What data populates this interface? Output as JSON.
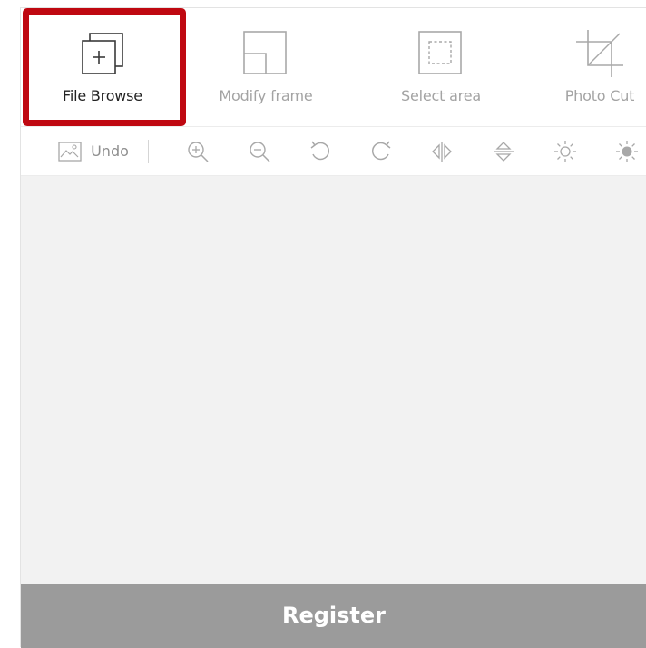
{
  "toolbar": {
    "tools": [
      {
        "label": "File Browse",
        "icon": "file-browse-icon",
        "active": true
      },
      {
        "label": "Modify frame",
        "icon": "modify-frame-icon",
        "active": false
      },
      {
        "label": "Select area",
        "icon": "select-area-icon",
        "active": false
      },
      {
        "label": "Photo Cut",
        "icon": "crop-icon",
        "active": false
      }
    ]
  },
  "subtoolbar": {
    "undo_label": "Undo",
    "icons": [
      "image-icon",
      "zoom-in-icon",
      "zoom-out-icon",
      "rotate-left-icon",
      "rotate-right-icon",
      "flip-horizontal-icon",
      "flip-vertical-icon",
      "brightness-down-icon",
      "brightness-up-icon"
    ]
  },
  "footer": {
    "register_label": "Register"
  },
  "colors": {
    "highlight": "#bf0811",
    "register_bg": "#9b9b9b",
    "canvas_bg": "#f2f2f2",
    "icon_inactive": "#a8a8a8",
    "icon_active": "#3a3a3a"
  }
}
